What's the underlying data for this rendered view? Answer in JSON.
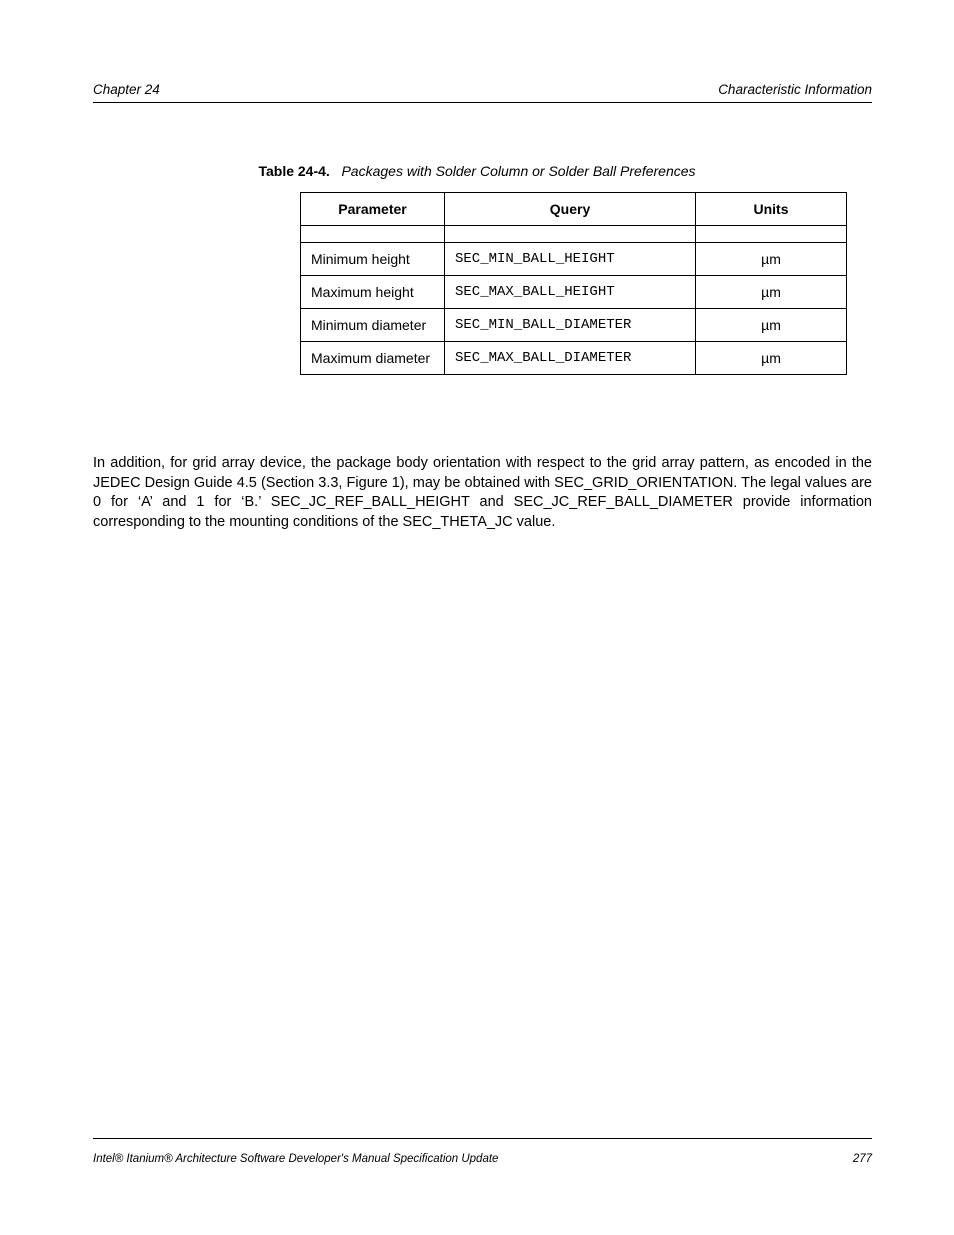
{
  "header": {
    "left": "Chapter 24",
    "right": "Characteristic Information"
  },
  "table": {
    "label": "Table 24-4.",
    "title": "Packages with Solder Column or Solder Ball Preferences",
    "headers": [
      "Parameter",
      "Query",
      "Units"
    ],
    "rows": [
      {
        "param": "Minimum height",
        "query": "SEC_MIN_BALL_HEIGHT",
        "units": "µm"
      },
      {
        "param": "Maximum height",
        "query": "SEC_MAX_BALL_HEIGHT",
        "units": "µm"
      },
      {
        "param": "Minimum diameter",
        "query": "SEC_MIN_BALL_DIAMETER",
        "units": "µm"
      },
      {
        "param": "Maximum diameter",
        "query": "SEC_MAX_BALL_DIAMETER",
        "units": "µm"
      }
    ]
  },
  "paragraphs": [
    "In addition, for grid array device, the package body orientation with respect to the grid array pattern, as encoded in the JEDEC Design Guide 4.5 (Section 3.3, Figure 1), may be obtained with SEC_GRID_ORIENTATION. The legal values are 0 for ‘A’ and 1 for ‘B.’ SEC_JC_REF_BALL_HEIGHT and SEC_JC_REF_BALL_DIAMETER provide information corresponding to the mounting conditions of the SEC_THETA_JC value."
  ],
  "footer": {
    "left": "Intel® Itanium® Architecture Software Developer's Manual Specification Update",
    "right": "277"
  }
}
